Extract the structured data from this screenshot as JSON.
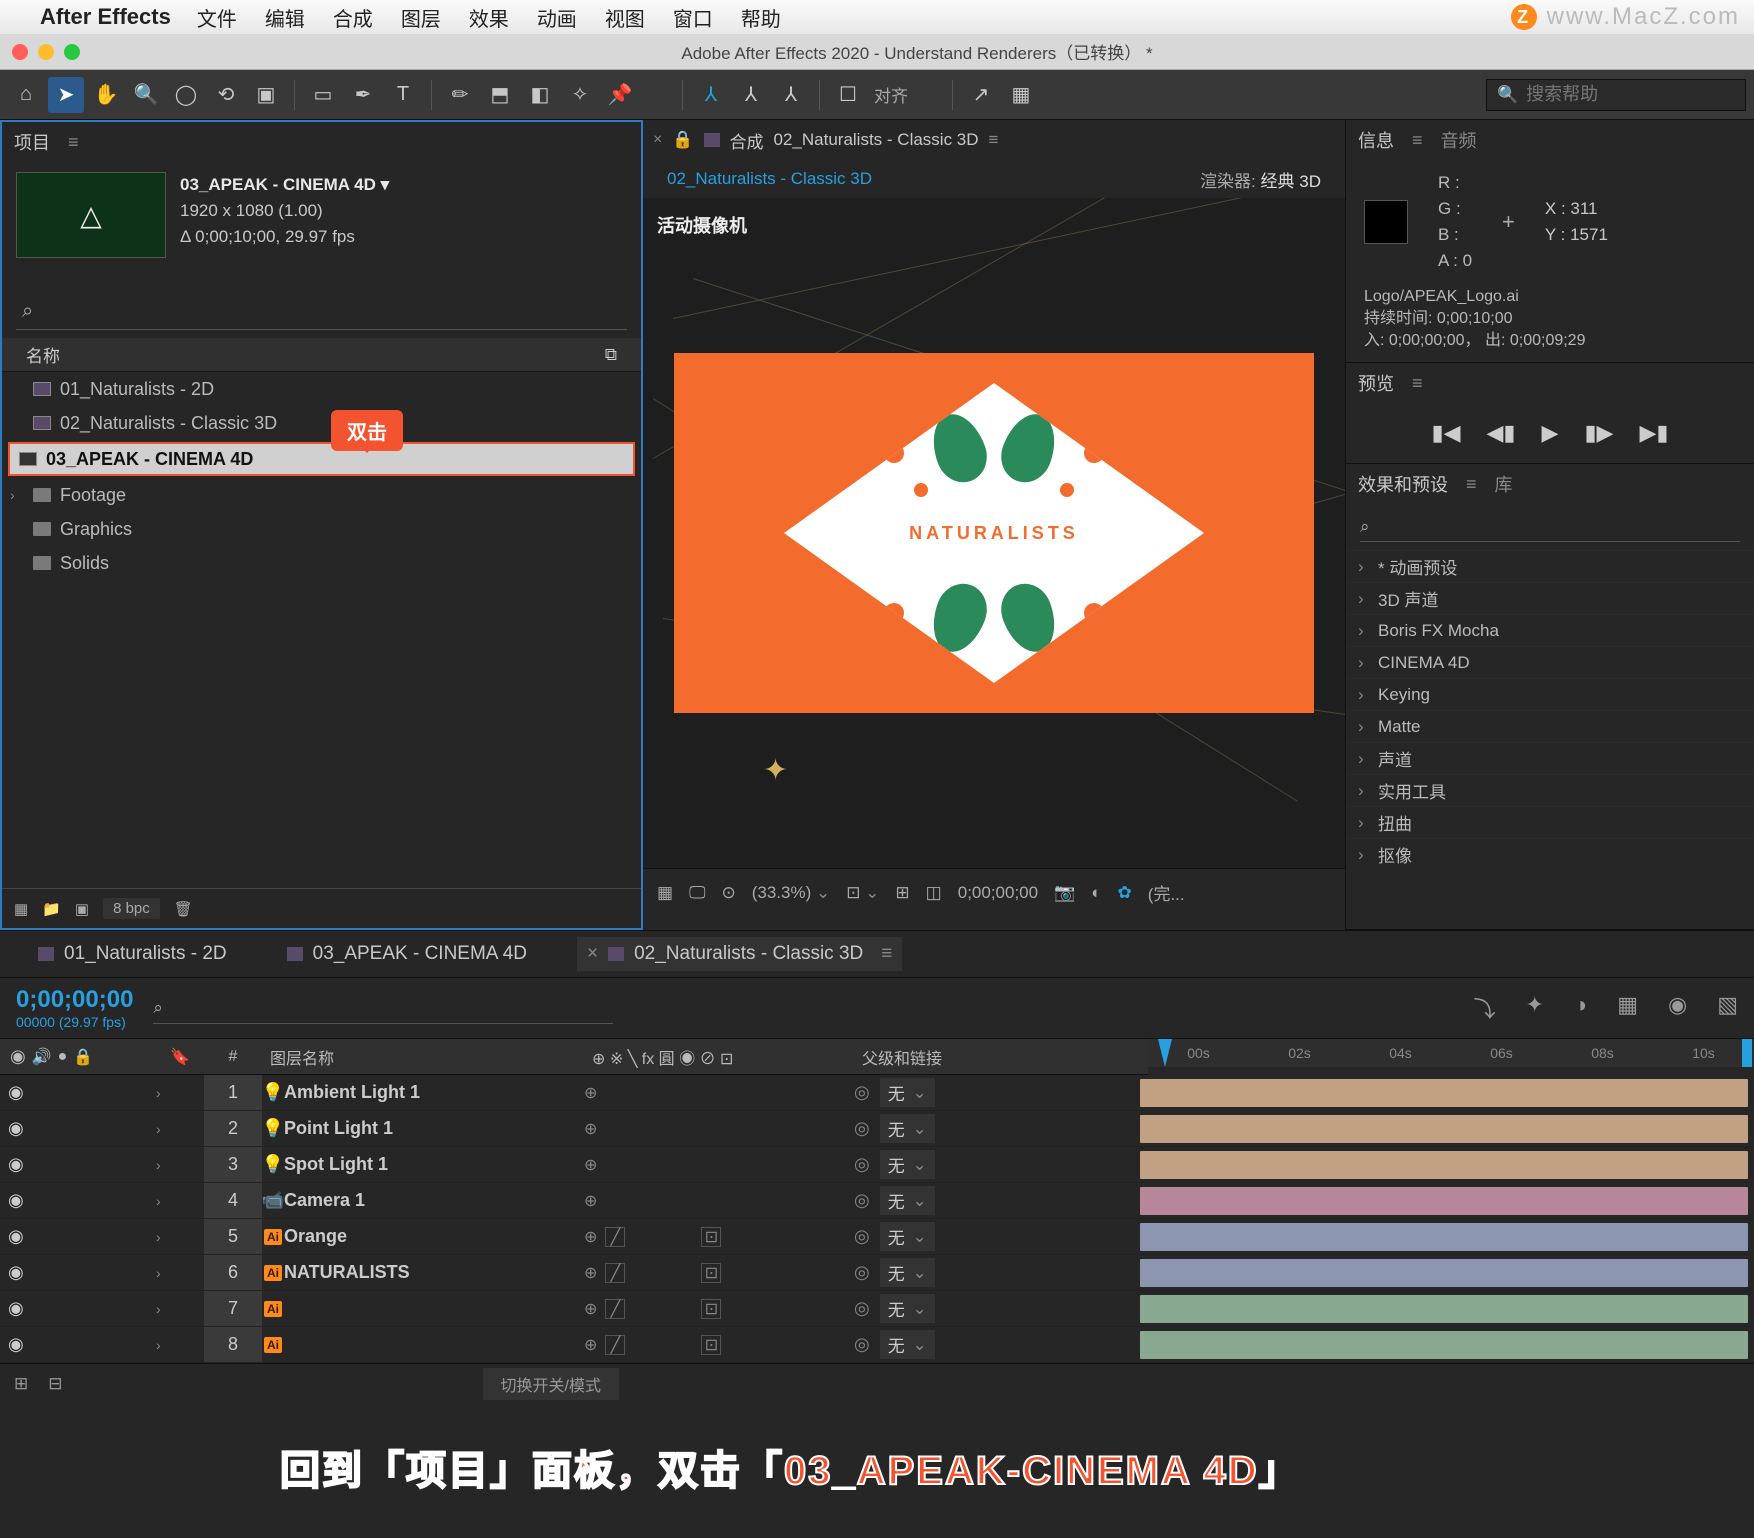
{
  "menubar": {
    "app_name": "After Effects",
    "items": [
      "文件",
      "编辑",
      "合成",
      "图层",
      "效果",
      "动画",
      "视图",
      "窗口",
      "帮助"
    ],
    "watermark": "www.MacZ.com"
  },
  "titlebar": {
    "title": "Adobe After Effects 2020 - Understand Renderers（已转换） *"
  },
  "toolbar": {
    "align_label": "对齐",
    "search_placeholder": "搜索帮助",
    "search_icon": "🔍"
  },
  "project": {
    "tab_label": "项目",
    "selected_name": "03_APEAK - CINEMA 4D ▾",
    "resolution": "1920 x 1080 (1.00)",
    "duration": "Δ 0;00;10;00, 29.97 fps",
    "search_icon": "⌕",
    "header_name": "名称",
    "items": [
      {
        "type": "comp",
        "name": "01_Naturalists - 2D"
      },
      {
        "type": "comp",
        "name": "02_Naturalists - Classic 3D"
      },
      {
        "type": "comp",
        "name": "03_APEAK - CINEMA 4D",
        "highlight": true
      },
      {
        "type": "folder",
        "name": "Footage"
      },
      {
        "type": "folder",
        "name": "Graphics"
      },
      {
        "type": "folder",
        "name": "Solids"
      }
    ],
    "callout": "双击",
    "bpc": "8 bpc"
  },
  "composition": {
    "tab_prefix": "合成",
    "tab_name": "02_Naturalists - Classic 3D",
    "subtab_name": "02_Naturalists - Classic 3D",
    "renderer_label": "渲染器:",
    "renderer_value": "经典 3D",
    "camera_label": "活动摄像机",
    "artwork_text": "NATURALISTS",
    "zoom": "(33.3%)",
    "timecode": "0;00;00;00",
    "quality": "(完..."
  },
  "info": {
    "tab_info": "信息",
    "tab_audio": "音频",
    "r": "R :",
    "g": "G :",
    "b": "B :",
    "a": "A :  0",
    "x": "X :  311",
    "y": "Y : 1571",
    "file": "Logo/APEAK_Logo.ai",
    "dur": "持续时间: 0;00;10;00",
    "inout": "入: 0;00;00;00， 出: 0;00;09;29"
  },
  "preview": {
    "tab": "预览"
  },
  "effects": {
    "tab_fx": "效果和预设",
    "tab_lib": "库",
    "items": [
      "* 动画预设",
      "3D 声道",
      "Boris FX Mocha",
      "CINEMA 4D",
      "Keying",
      "Matte",
      "声道",
      "实用工具",
      "扭曲",
      "抠像"
    ]
  },
  "timeline": {
    "tabs": [
      "01_Naturalists - 2D",
      "03_APEAK - CINEMA 4D",
      "02_Naturalists - Classic 3D"
    ],
    "active_tab_index": 2,
    "current_time": "0;00;00;00",
    "frame_info": "00000 (29.97 fps)",
    "ruler": [
      "00s",
      "02s",
      "04s",
      "06s",
      "08s",
      "10s"
    ],
    "columns": {
      "name": "图层名称",
      "parent": "父级和链接",
      "num": "#"
    },
    "switches": "⊕ ※ ╲ fx 圓 ◉ ⊘ ⊡",
    "rows": [
      {
        "n": "1",
        "color": "#f0c090",
        "icon": "light",
        "name": "Ambient Light 1",
        "track": "#c2a084",
        "parent": "无"
      },
      {
        "n": "2",
        "color": "#f0c090",
        "icon": "light",
        "name": "Point Light 1",
        "track": "#c2a084",
        "parent": "无"
      },
      {
        "n": "3",
        "color": "#f0c090",
        "icon": "light",
        "name": "Spot Light 1",
        "track": "#c2a084",
        "parent": "无"
      },
      {
        "n": "4",
        "color": "#e8a0c0",
        "icon": "camera",
        "name": "Camera 1",
        "track": "#b7869b",
        "parent": "无"
      },
      {
        "n": "5",
        "color": "#a8b8e8",
        "icon": "ai",
        "name": "Orange",
        "track": "#8c96b0",
        "parent": "无",
        "has3d": true
      },
      {
        "n": "6",
        "color": "#a8b8e8",
        "icon": "ai",
        "name": "NATURALISTS",
        "track": "#8c96b0",
        "parent": "无",
        "has3d": true
      },
      {
        "n": "7",
        "color": "#a8e8b8",
        "icon": "ai",
        "name": "",
        "track": "#88a890",
        "parent": "无",
        "has3d": true
      },
      {
        "n": "8",
        "color": "#a8e8b8",
        "icon": "ai",
        "name": "",
        "track": "#88a890",
        "parent": "无",
        "has3d": true
      }
    ],
    "footer_button": "切换开关/模式"
  },
  "instruction": "回到「项目」面板，双击「03_APEAK-CINEMA 4D」"
}
